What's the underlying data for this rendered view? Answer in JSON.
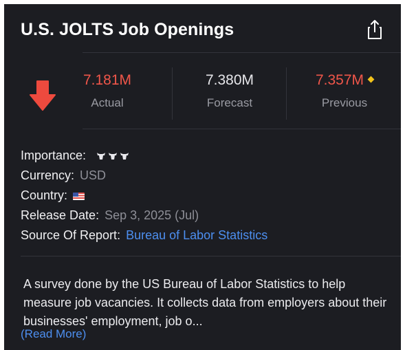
{
  "header": {
    "title": "U.S. JOLTS Job Openings",
    "share_icon": "share-icon"
  },
  "stats": {
    "direction_icon": "down-arrow-icon",
    "actual": {
      "value": "7.181M",
      "label": "Actual",
      "color": "#f0564a"
    },
    "forecast": {
      "value": "7.380M",
      "label": "Forecast",
      "color": "#e6e6ea"
    },
    "previous": {
      "value": "7.357M",
      "label": "Previous",
      "color": "#f0564a",
      "revised_marker": "diamond-icon",
      "marker_color": "#f2c31b"
    }
  },
  "details": {
    "importance_label": "Importance:",
    "importance_level": 3,
    "currency_label": "Currency:",
    "currency_value": "USD",
    "country_label": "Country:",
    "country_flag": "us-flag-icon",
    "release_label": "Release Date:",
    "release_value": "Sep 3, 2025 (Jul)",
    "source_label": "Source Of Report:",
    "source_value": "Bureau of Labor Statistics"
  },
  "description": {
    "text": "A survey done by the US Bureau of Labor Statistics to help measure job vacancies. It collects data from employers about their businesses' employment, job o...",
    "read_more": "(Read More)"
  },
  "colors": {
    "background": "#1c1d22",
    "accent_link": "#4d8ff0",
    "negative": "#f0564a"
  }
}
